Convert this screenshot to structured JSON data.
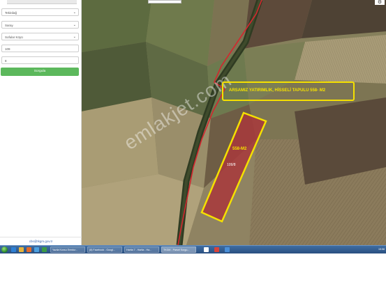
{
  "panel": {
    "province": "Tekirdağ",
    "district": "Saray",
    "neighborhood": "Sofular Köyü",
    "block_value": "109",
    "parcel_value": "8",
    "query_label": "Sorgula",
    "contact_email": "cbs@tkgm.gov.tr"
  },
  "map": {
    "annotation_title": "ARSAMIZ YATIRIMLIK, HİSSELİ TAPULU 558- M2",
    "parcel_label": "558-M2",
    "parcel_number": "109/8",
    "watermark": "emlakjet.com",
    "credit": "",
    "colors": {
      "highlight": "#f5e000",
      "parcel_fill": "#a8383c",
      "boundary": "#d3262e"
    },
    "icons": {
      "settings": "gear-icon"
    }
  },
  "taskbar": {
    "tasks": [
      {
        "label": "Yazila Konsu Emrdur..."
      },
      {
        "label": "(8) Facebook - Googl..."
      },
      {
        "label": "Harita 7 - Harita - Ha..."
      },
      {
        "label": "TKGM - Parsel Sorgu..."
      }
    ],
    "clock": "15:58"
  }
}
